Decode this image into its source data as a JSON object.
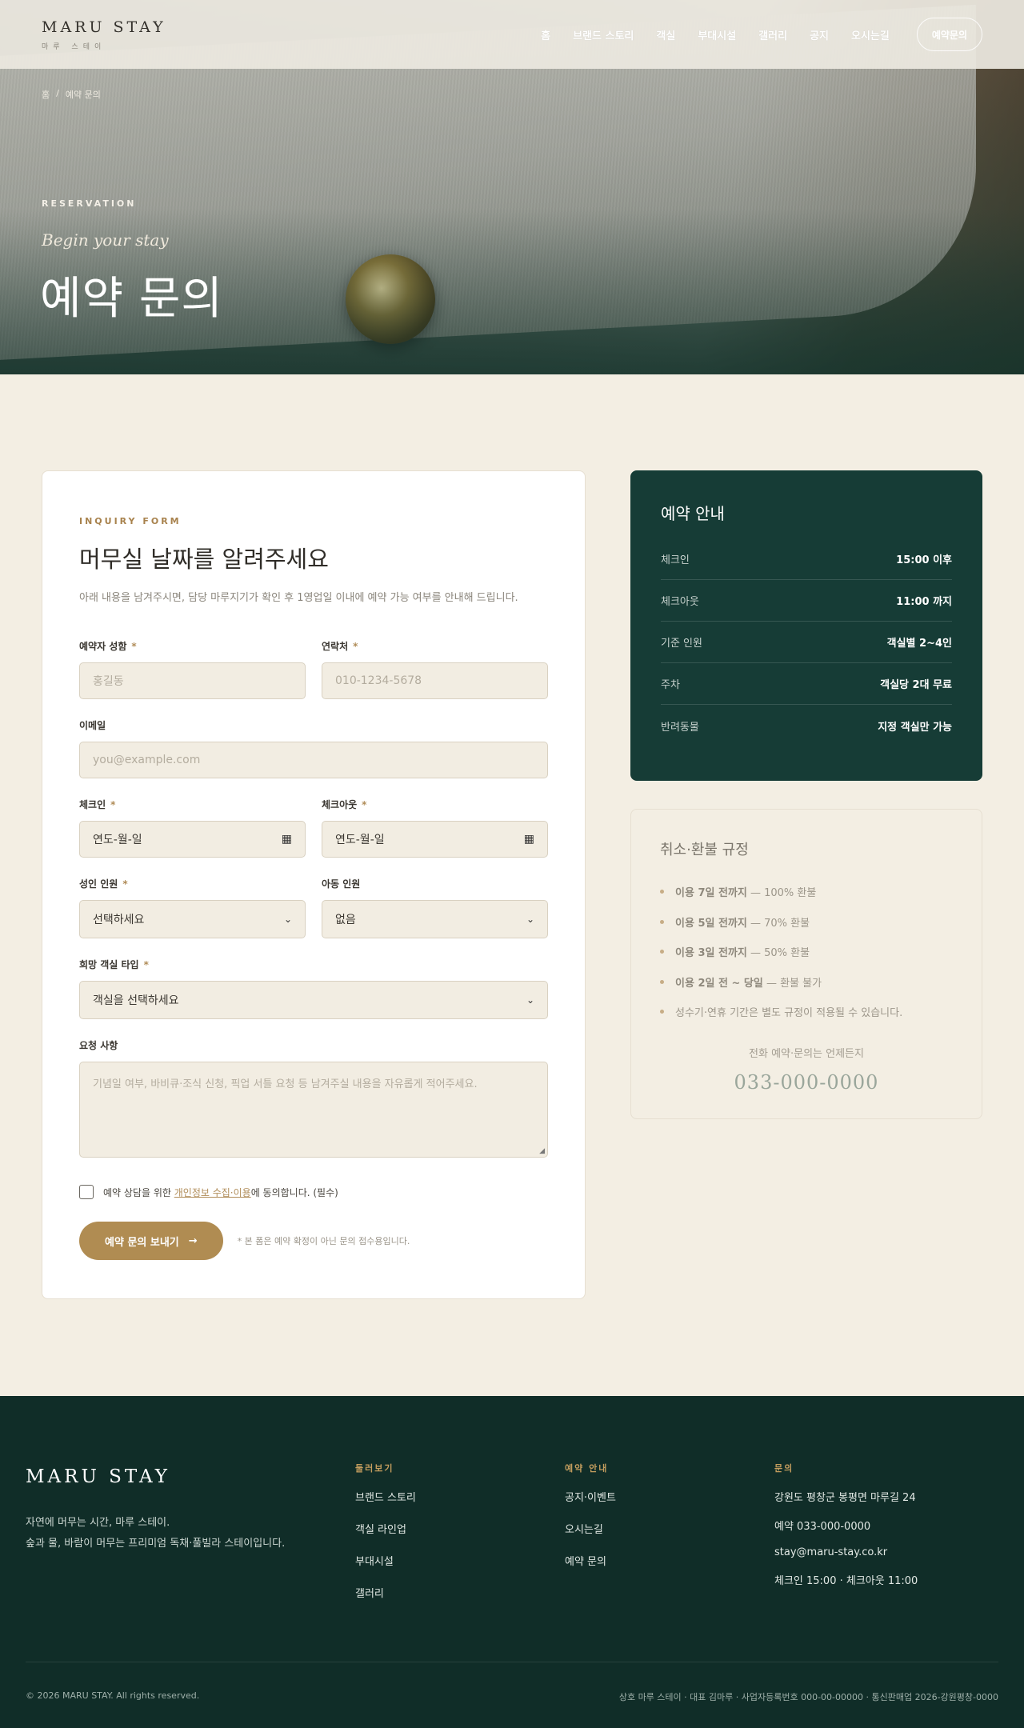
{
  "header": {
    "logo": "MARU STAY",
    "logo_sub": "마루 스테이",
    "nav": [
      "홈",
      "브랜드 스토리",
      "객실",
      "부대시설",
      "갤러리",
      "공지",
      "오시는길"
    ],
    "cta": "예약문의"
  },
  "hero": {
    "breadcrumb": [
      "홈",
      "/",
      "예약 문의"
    ],
    "eyebrow": "RESERVATION",
    "script": "Begin your stay",
    "title": "예약 문의"
  },
  "form": {
    "eyebrow": "INQUIRY FORM",
    "title": "머무실 날짜를 알려주세요",
    "desc": "아래 내용을 남겨주시면, 담당 마루지기가 확인 후 1영업일 이내에 예약 가능 여부를 안내해 드립니다.",
    "name": {
      "label": "예약자 성함",
      "required": "*",
      "placeholder": "홍길동"
    },
    "phone": {
      "label": "연락처",
      "required": "*",
      "placeholder": "010-1234-5678"
    },
    "email": {
      "label": "이메일",
      "placeholder": "you@example.com"
    },
    "checkin": {
      "label": "체크인",
      "required": "*",
      "value": "연도-월-일"
    },
    "checkout": {
      "label": "체크아웃",
      "required": "*",
      "value": "연도-월-일"
    },
    "adults": {
      "label": "성인 인원",
      "required": "*",
      "value": "선택하세요"
    },
    "children": {
      "label": "아동 인원",
      "value": "없음"
    },
    "room": {
      "label": "희망 객실 타입",
      "required": "*",
      "value": "객실을 선택하세요"
    },
    "request": {
      "label": "요청 사항",
      "placeholder": "기념일 여부, 바비큐·조식 신청, 픽업 서틀 요청 등 남겨주실 내용을 자유롭게 적어주세요."
    },
    "agree": {
      "pre": "예약 상담을 위한 ",
      "link": "개인정보 수집·이용",
      "post": "에 동의합니다. (필수)"
    },
    "submit": "예약 문의 보내기",
    "submit_arrow": "→",
    "note": "* 본 폼은 예약 확정이 아닌 문의 접수용입니다."
  },
  "guide": {
    "title": "예약 안내",
    "rows": [
      {
        "key": "체크인",
        "value": "15:00 이후"
      },
      {
        "key": "체크아웃",
        "value": "11:00 까지"
      },
      {
        "key": "기준 인원",
        "value": "객실별 2~4인"
      },
      {
        "key": "주차",
        "value": "객실당 2대 무료"
      },
      {
        "key": "반려동물",
        "value": "지정 객실만 가능"
      }
    ]
  },
  "policy": {
    "title": "취소·환불 규정",
    "items": [
      {
        "bold": "이용 7일 전까지",
        "rest": " — 100% 환불"
      },
      {
        "bold": "이용 5일 전까지",
        "rest": " — 70% 환불"
      },
      {
        "bold": "이용 3일 전까지",
        "rest": " — 50% 환불"
      },
      {
        "bold": "이용 2일 전 ~ 당일",
        "rest": " — 환불 불가"
      },
      {
        "bold": "",
        "rest": "성수기·연휴 기간은 별도 규정이 적용될 수 있습니다."
      }
    ],
    "call_label": "전화 예약·문의는 언제든지",
    "phone": "033-000-0000"
  },
  "footer": {
    "logo": "MARU STAY",
    "desc_line1": "자연에 머무는 시간, 마루 스테이.",
    "desc_line2": "숲과 물, 바람이 머무는 프리미엄 독채·풀빌라 스테이입니다.",
    "col1_title": "둘러보기",
    "col1_links": [
      "브랜드 스토리",
      "객실 라인업",
      "부대시설",
      "갤러리"
    ],
    "col2_title": "예약 안내",
    "col2_links": [
      "공지·이벤트",
      "오시는길",
      "예약 문의"
    ],
    "col3_title": "문의",
    "col3_lines": [
      "강원도 평창군 봉평면 마루길 24",
      "예약 033-000-0000",
      "stay@maru-stay.co.kr",
      "체크인 15:00 · 체크아웃 11:00"
    ],
    "copyright": "© 2026 MARU STAY. All rights reserved.",
    "business": "상호 마루 스테이 · 대표 김마루 · 사업자등록번호 000-00-00000 · 통신판매업 2026-강원평창-0000"
  },
  "colors": {
    "accent_gold": "#b08c52",
    "deep_green": "#163c36",
    "footer_green": "#102d28",
    "cream": "#f3eee3"
  }
}
